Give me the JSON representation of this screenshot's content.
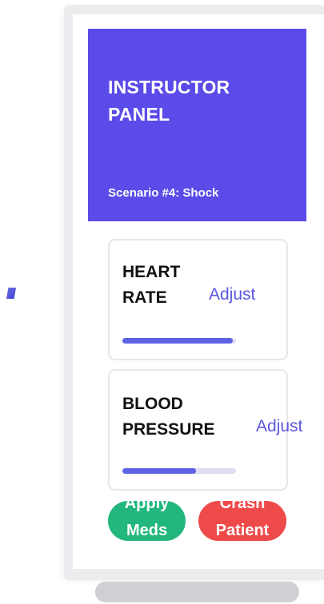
{
  "panel": {
    "title": "INSTRUCTOR PANEL",
    "subtitle": "Scenario #4: Shock"
  },
  "vitals": [
    {
      "label": "HEART RATE",
      "action": "Adjust",
      "level": 0.97
    },
    {
      "label": "BLOOD PRESSURE",
      "action": "Adjust",
      "level": 0.65
    }
  ],
  "actions": {
    "meds_label": "Apply Meds",
    "crash_label": "Crash Patient"
  },
  "colors": {
    "header": "#5b4be8",
    "accent": "#5e63e6",
    "meds": "#22b77c",
    "crash": "#ee4a4a"
  }
}
